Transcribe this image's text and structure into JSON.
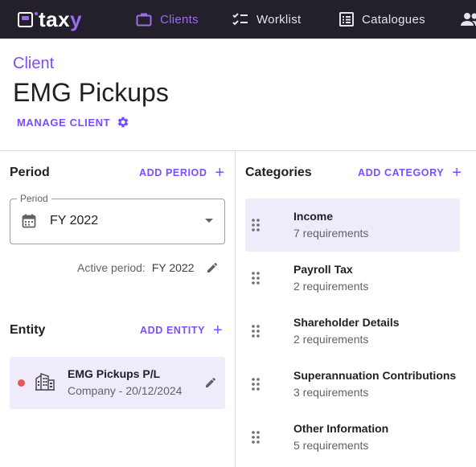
{
  "app": {
    "logo_text": "taxy",
    "brand_color": "#9b6cf0",
    "nav_bg": "#23202b"
  },
  "nav": {
    "items": [
      {
        "label": "Clients",
        "icon": "briefcase-icon",
        "active": true
      },
      {
        "label": "Worklist",
        "icon": "checklist-icon",
        "active": false
      },
      {
        "label": "Catalogues",
        "icon": "catalogue-icon",
        "active": false
      },
      {
        "label": "",
        "icon": "people-icon",
        "active": false
      }
    ]
  },
  "header": {
    "breadcrumb": "Client",
    "title": "EMG Pickups",
    "manage_label": "MANAGE CLIENT",
    "manage_icon": "gear-icon"
  },
  "period": {
    "title": "Period",
    "add_label": "ADD PERIOD",
    "select_label": "Period",
    "select_value": "FY 2022",
    "active_label": "Active period:",
    "active_value": "FY 2022"
  },
  "entity": {
    "title": "Entity",
    "add_label": "ADD ENTITY",
    "items": [
      {
        "name": "EMG Pickups P/L",
        "subtitle": "Company - 20/12/2024",
        "status_color": "#e45858",
        "icon": "building-icon"
      }
    ]
  },
  "categories": {
    "title": "Categories",
    "add_label": "ADD CATEGORY",
    "items": [
      {
        "name": "Income",
        "count": "7 requirements",
        "selected": true
      },
      {
        "name": "Payroll Tax",
        "count": "2 requirements",
        "selected": false
      },
      {
        "name": "Shareholder Details",
        "count": "2 requirements",
        "selected": false
      },
      {
        "name": "Superannuation Contributions",
        "count": "3 requirements",
        "selected": false
      },
      {
        "name": "Other Information",
        "count": "5 requirements",
        "selected": false
      }
    ]
  }
}
